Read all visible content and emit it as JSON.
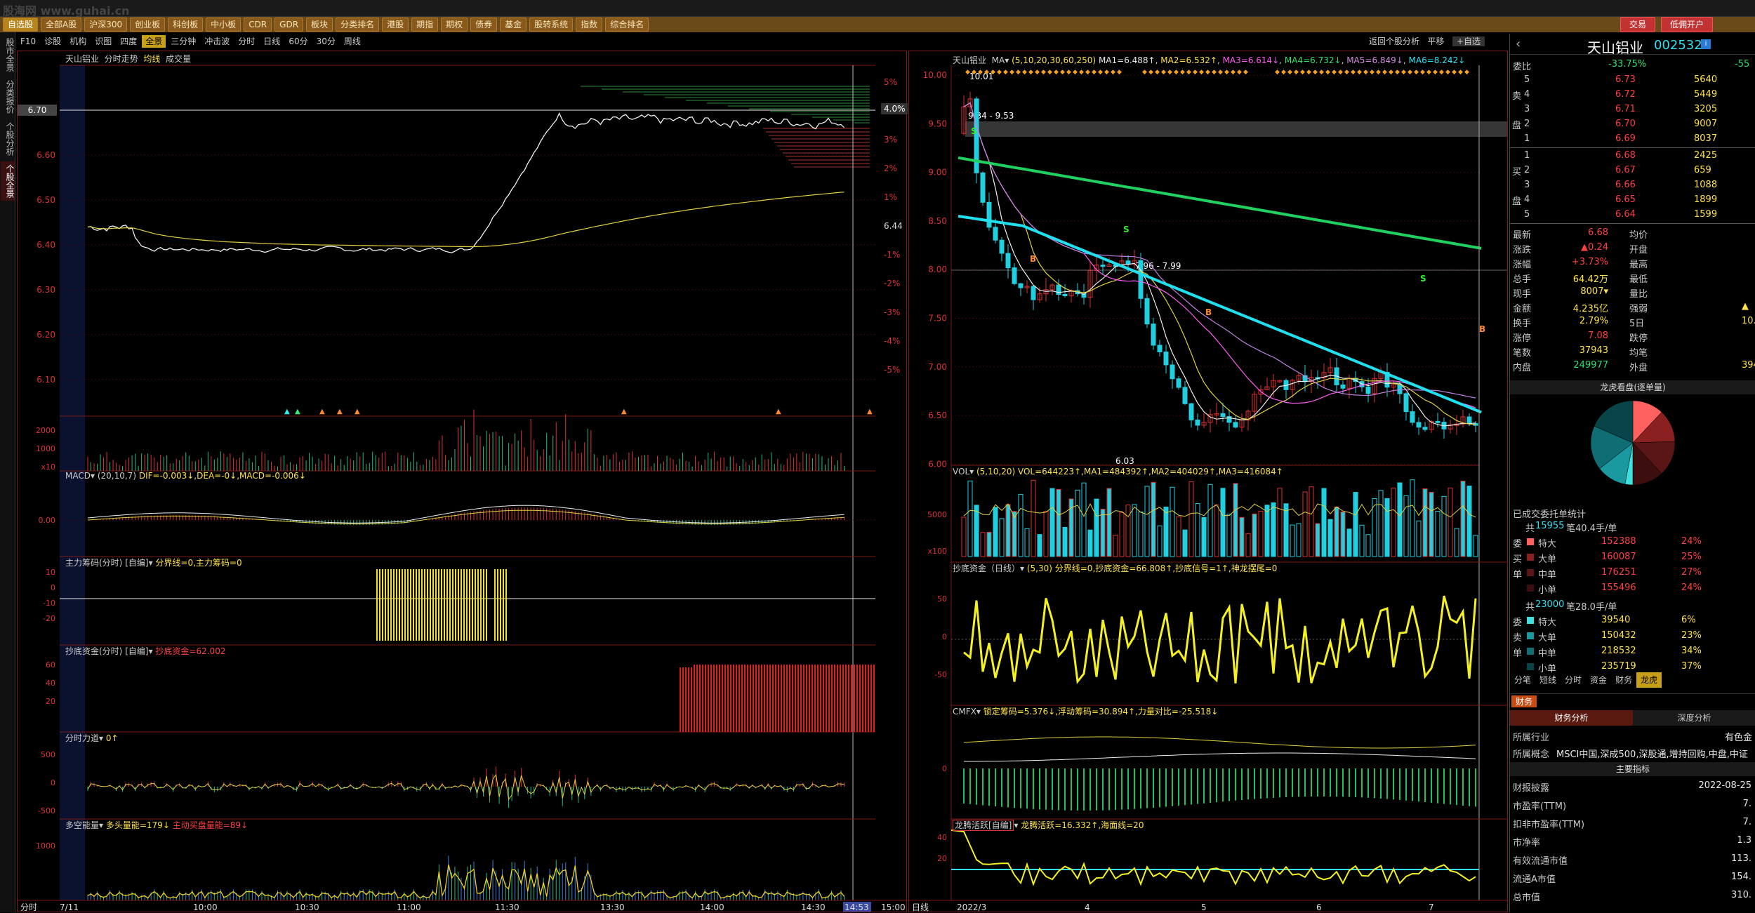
{
  "watermark": "股海网 www.guhai.cn",
  "menu": {
    "items": [
      "自选股",
      "全部A股",
      "沪深300",
      "创业板",
      "科创板",
      "中小板",
      "CDR",
      "GDR",
      "板块",
      "分类排名",
      "港股",
      "期指",
      "期权",
      "债券",
      "基金",
      "股转系统",
      "指数",
      "综合排名"
    ],
    "active_index": 0,
    "trade_btn": "交易",
    "open_account_btn": "低佣开户"
  },
  "side_tabs": [
    "股市全景",
    "分类报价",
    "个股分析",
    "个股全景"
  ],
  "side_active": 3,
  "period_bar": {
    "items": [
      "F10",
      "诊股",
      "机构",
      "识图",
      "四度",
      "全景",
      "三分钟",
      "冲击波",
      "分时",
      "日线",
      "60分",
      "30分",
      "周线"
    ],
    "active": "全景"
  },
  "left_chart": {
    "stock_name": "天山铝业",
    "title_items": [
      "分时走势",
      "均线",
      "成交量"
    ],
    "price_ticks": [
      "6.70",
      "6.60",
      "6.50",
      "6.40",
      "6.30",
      "6.20",
      "6.10"
    ],
    "pct_ticks": [
      "5%",
      "4.0%",
      "3%",
      "2%",
      "1%",
      "6.44",
      "-1%",
      "-2%",
      "-3%",
      "-4%",
      "-5%"
    ],
    "current_price": "6.70",
    "current_pct": "4.0%",
    "vol_ticks": [
      "2000",
      "1000",
      "x10"
    ],
    "time_ticks": [
      "分时",
      "7/11",
      "10:00",
      "10:30",
      "11:00",
      "11:30",
      "13:30",
      "14:00",
      "14:30",
      "14:53",
      "15:00"
    ],
    "macd_title": "MACD",
    "macd_params": "(20,10,7)",
    "macd_vals": "DIF=-0.003↓,DEA=-0↓,MACD=-0.006↓",
    "macd_tick": "0.00",
    "zljm_title": "主力筹码(分时)",
    "zljm_sub": "[自编]",
    "zljm_vals": "分界线=0,主力筹码=0",
    "zljm_ticks": [
      "10",
      "0",
      "-10",
      "-20"
    ],
    "cdzj_title": "抄底资金(分时)",
    "cdzj_sub": "[自编]",
    "cdzj_vals": "抄底资金=62.002",
    "cdzj_ticks": [
      "60",
      "40",
      "20"
    ],
    "fsld_title": "分时力道",
    "fsld_vals": "0↑",
    "fsld_ticks": [
      "500",
      "0",
      "-500"
    ],
    "dkln_title": "多空能量",
    "dkln_vals": "多头量能=179↓",
    "dkln_vals2": "主动买盘量能=89↓",
    "dkln_ticks": [
      "1000"
    ]
  },
  "mid_chart": {
    "stock_name": "天山铝业",
    "ma_label": "MA",
    "ma_params": "(5,10,20,30,60,250)",
    "ma_vals": [
      "MA1=6.488↑",
      "MA2=6.532↑",
      "MA3=6.614↓",
      "MA4=6.732↓",
      "MA5=6.849↓",
      "MA6=8.242↓"
    ],
    "price_ticks": [
      "10.00",
      "9.50",
      "9.00",
      "8.50",
      "8.00",
      "7.50",
      "7.00",
      "6.50",
      "6.00"
    ],
    "annot_high": "10.01",
    "annot_range1": "9.34 - 9.53",
    "annot_range2": "7.96 - 7.99",
    "annot_low": "6.03",
    "vol_title": "VOL",
    "vol_params": "(5,10,20)",
    "vol_vals": "VOL=644223↑,MA1=484392↑,MA2=404029↑,MA3=416084↑",
    "vol_ticks": [
      "5000",
      "x100"
    ],
    "cdzj_title": "抄底资金（日线）",
    "cdzj_vals": "(5,30) 分界线=0,抄底资金=66.808↑,抄底信号=1↑,神龙摆尾=0",
    "cdzj_ticks": [
      "50",
      "0",
      "-50"
    ],
    "cmfx_title": "CMFX",
    "cmfx_vals": "锁定筹码=5.376↓,浮动筹码=30.894↑,力量对比=-25.518↓",
    "cmfx_tick": "0",
    "lthy_title": "龙腾活跃[自编]",
    "lthy_vals": "龙腾活跃=16.332↑,海面线=20",
    "lthy_ticks": [
      "40",
      "20"
    ],
    "date_ticks": [
      "日线",
      "2022/3",
      "4",
      "5",
      "6",
      "7"
    ],
    "back_btn": "返回个股分析",
    "flat_btn": "平移",
    "select_btn": "+自选"
  },
  "right_panel": {
    "name": "天山铝业",
    "code": "002532",
    "weibi_label": "委比",
    "weibi_value": "-33.75%",
    "weicha_value": "-55",
    "sell_rows": [
      {
        "label": "5",
        "price": "6.73",
        "vol": "5640"
      },
      {
        "label": "4",
        "price": "6.72",
        "vol": "5449"
      },
      {
        "label": "3",
        "price": "6.71",
        "vol": "3205"
      },
      {
        "label": "2",
        "price": "6.70",
        "vol": "9007"
      },
      {
        "label": "1",
        "price": "6.69",
        "vol": "8037"
      }
    ],
    "buy_rows": [
      {
        "label": "1",
        "price": "6.68",
        "vol": "2425"
      },
      {
        "label": "2",
        "price": "6.67",
        "vol": "659"
      },
      {
        "label": "3",
        "price": "6.66",
        "vol": "1088"
      },
      {
        "label": "4",
        "price": "6.65",
        "vol": "1899"
      },
      {
        "label": "5",
        "price": "6.64",
        "vol": "1599"
      }
    ],
    "sell_side_labels": [
      "卖",
      "盘"
    ],
    "buy_side_labels": [
      "买",
      "盘"
    ],
    "stats": [
      {
        "k": "最新",
        "v": "6.68",
        "k2": "均价",
        "v2": "",
        "c": "red"
      },
      {
        "k": "涨跌",
        "v": "▲0.24",
        "k2": "开盘",
        "v2": "",
        "c": "red"
      },
      {
        "k": "涨幅",
        "v": "+3.73%",
        "k2": "最高",
        "v2": "",
        "c": "red"
      },
      {
        "k": "总手",
        "v": "64.42万",
        "k2": "最低",
        "v2": "",
        "c": "yellow"
      },
      {
        "k": "现手",
        "v": "8007▾",
        "k2": "量比",
        "v2": "",
        "c": "yellow"
      },
      {
        "k": "金额",
        "v": "4.235亿",
        "k2": "强弱",
        "v2": "▲",
        "c": "yellow"
      },
      {
        "k": "换手",
        "v": "2.79%",
        "k2": "5日",
        "v2": "10.",
        "c": "yellow"
      },
      {
        "k": "涨停",
        "v": "7.08",
        "k2": "跌停",
        "v2": "",
        "c": "red"
      },
      {
        "k": "笔数",
        "v": "37943",
        "k2": "均笔",
        "v2": "",
        "c": "yellow"
      },
      {
        "k": "内盘",
        "v": "249977",
        "k2": "外盘",
        "v2": "394",
        "c": "green"
      }
    ],
    "lhk_title": "龙虎看盘(逐单量)",
    "pie_slices": [
      {
        "v": 24,
        "color": "#ff6060"
      },
      {
        "v": 25,
        "color": "#8a2020"
      },
      {
        "v": 27,
        "color": "#5a1616"
      },
      {
        "v": 24,
        "color": "#3c0e0e"
      },
      {
        "v": 6,
        "color": "#40e0e0"
      },
      {
        "v": 23,
        "color": "#1a9aa0"
      },
      {
        "v": 34,
        "color": "#0f6e74"
      },
      {
        "v": 37,
        "color": "#084448"
      }
    ],
    "deal_title": "已成交委托单统计",
    "sell_summary_prefix": "共",
    "sell_summary_count": "15955",
    "sell_summary_suffix": "笔40.4手/单",
    "sell_groups": [
      {
        "name": "特大",
        "vol": "152388",
        "pct": "24%"
      },
      {
        "name": "大单",
        "vol": "160087",
        "pct": "25%"
      },
      {
        "name": "中单",
        "vol": "176251",
        "pct": "27%"
      },
      {
        "name": "小单",
        "vol": "155496",
        "pct": "24%"
      }
    ],
    "sell_side": [
      "委",
      "买",
      "单"
    ],
    "buy_summary_prefix": "共",
    "buy_summary_count": "23000",
    "buy_summary_suffix": "笔28.0手/单",
    "buy_groups": [
      {
        "name": "特大",
        "vol": "39540",
        "pct": "6%"
      },
      {
        "name": "大单",
        "vol": "150432",
        "pct": "23%"
      },
      {
        "name": "中单",
        "vol": "218532",
        "pct": "34%"
      },
      {
        "name": "小单",
        "vol": "235719",
        "pct": "37%"
      }
    ],
    "buy_side": [
      "委",
      "卖",
      "单"
    ],
    "tabs": [
      "分笔",
      "短线",
      "分时",
      "资金",
      "财务",
      "龙虎"
    ],
    "tab_active": "龙虎",
    "finance_tab": "财务",
    "fin_tabs": [
      "财务分析",
      "深度分析"
    ],
    "industry_label": "所属行业",
    "industry_value": "有色金",
    "concept_label": "所属概念",
    "concept_value": "MSCI中国,深成500,深股通,增持回购,中盘,中证",
    "main_index": "主要指标",
    "fin_rows": [
      {
        "k": "财报披露",
        "v": "2022-08-25"
      },
      {
        "k": "市盈率(TTM)",
        "v": "7."
      },
      {
        "k": "扣非市盈率(TTM)",
        "v": "7."
      },
      {
        "k": "市净率",
        "v": "1.3"
      },
      {
        "k": "有效流通市值",
        "v": "113."
      },
      {
        "k": "流通A市值",
        "v": "154."
      },
      {
        "k": "总市值",
        "v": "310."
      }
    ]
  }
}
